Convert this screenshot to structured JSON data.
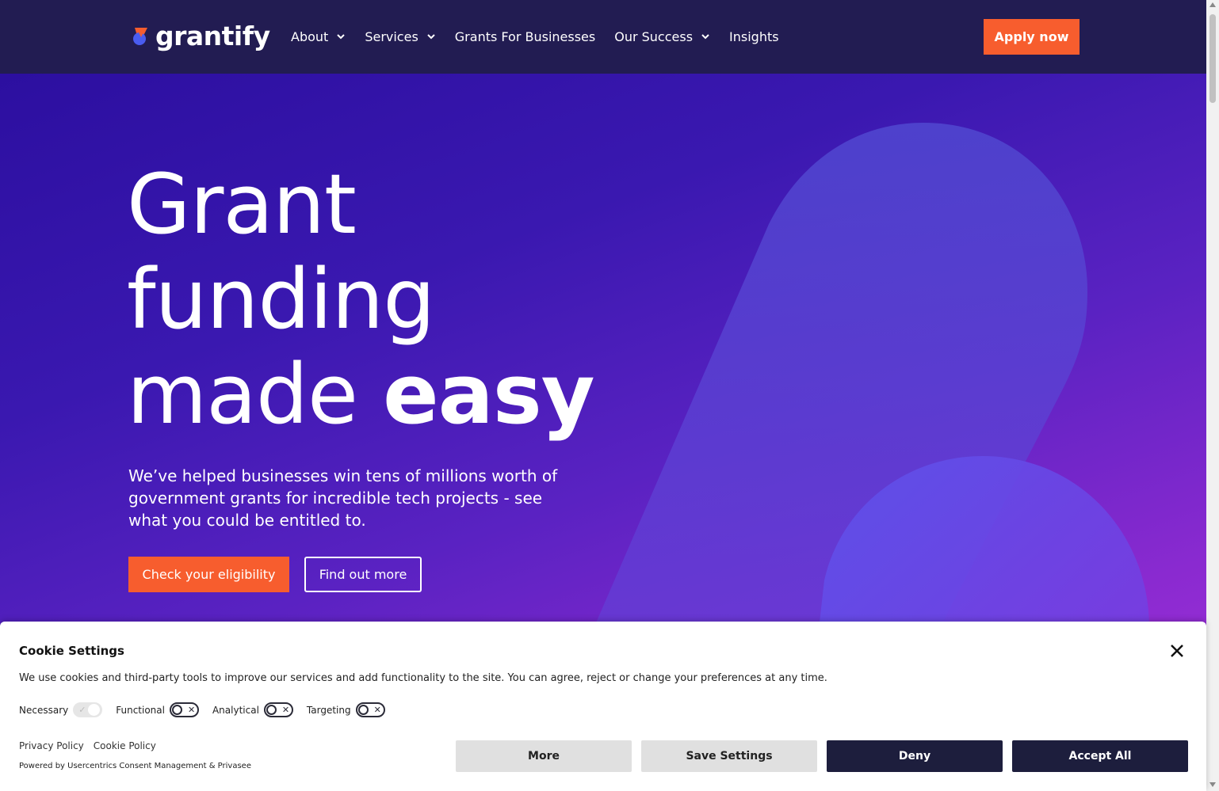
{
  "brand": {
    "name": "grantify",
    "accent": "#f75d2e",
    "navy": "#221c52"
  },
  "nav": {
    "items": [
      {
        "label": "About",
        "has_dropdown": true
      },
      {
        "label": "Services",
        "has_dropdown": true
      },
      {
        "label": "Grants For Businesses",
        "has_dropdown": false
      },
      {
        "label": "Our Success",
        "has_dropdown": true
      },
      {
        "label": "Insights",
        "has_dropdown": false
      }
    ],
    "cta": "Apply now"
  },
  "hero": {
    "line1": "Grant",
    "line2": "funding",
    "line3_regular": "made ",
    "line3_bold": "easy",
    "subtext": "We’ve helped businesses win tens of millions worth of government grants for incredible tech projects - see what you could be entitled to.",
    "primary_cta": "Check your eligibility",
    "secondary_cta": "Find out more"
  },
  "cookie": {
    "title": "Cookie Settings",
    "description": "We use cookies and third-party tools to improve our services and add functionality to the site. You can agree, reject or change your preferences at any time.",
    "toggles": [
      {
        "label": "Necessary",
        "state": "on-disabled"
      },
      {
        "label": "Functional",
        "state": "off"
      },
      {
        "label": "Analytical",
        "state": "off"
      },
      {
        "label": "Targeting",
        "state": "off"
      }
    ],
    "links": [
      "Privacy Policy",
      "Cookie Policy"
    ],
    "powered_by": "Powered by Usercentrics Consent Management & Privasee",
    "buttons": {
      "more": "More",
      "save": "Save Settings",
      "deny": "Deny",
      "accept": "Accept All"
    }
  }
}
